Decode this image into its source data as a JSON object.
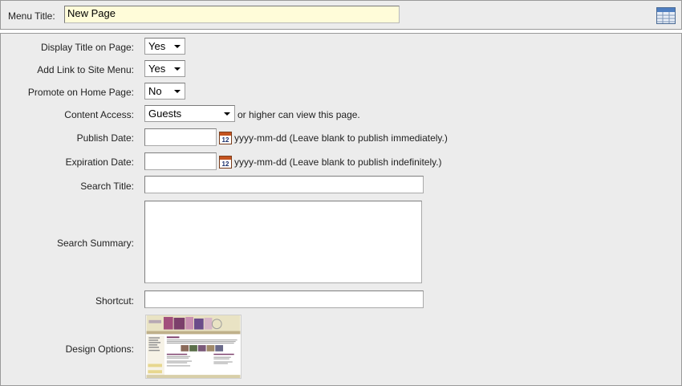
{
  "menu_title": {
    "label": "Menu Title:",
    "value": "New Page"
  },
  "form": {
    "display_title": {
      "label": "Display Title on Page:",
      "value": "Yes"
    },
    "add_link": {
      "label": "Add Link to Site Menu:",
      "value": "Yes"
    },
    "promote": {
      "label": "Promote on Home Page:",
      "value": "No"
    },
    "content_access": {
      "label": "Content Access:",
      "value": "Guests",
      "suffix": "or higher can view this page."
    },
    "publish_date": {
      "label": "Publish Date:",
      "value": "",
      "hint": "yyyy-mm-dd (Leave blank to publish immediately.)"
    },
    "expiration_date": {
      "label": "Expiration Date:",
      "value": "",
      "hint": "yyyy-mm-dd (Leave blank to publish indefinitely.)"
    },
    "search_title": {
      "label": "Search Title:",
      "value": ""
    },
    "search_summary": {
      "label": "Search Summary:",
      "value": ""
    },
    "shortcut": {
      "label": "Shortcut:",
      "value": ""
    },
    "design_options": {
      "label": "Design Options:"
    }
  },
  "calendar_day": "12",
  "icons": {
    "grid": "table-grid-icon",
    "calendar": "calendar-icon",
    "dropdown": "chevron-down-icon"
  },
  "colors": {
    "panel_bg": "#ececec",
    "title_input_bg": "#fffcd9",
    "border": "#9a9a9a"
  }
}
